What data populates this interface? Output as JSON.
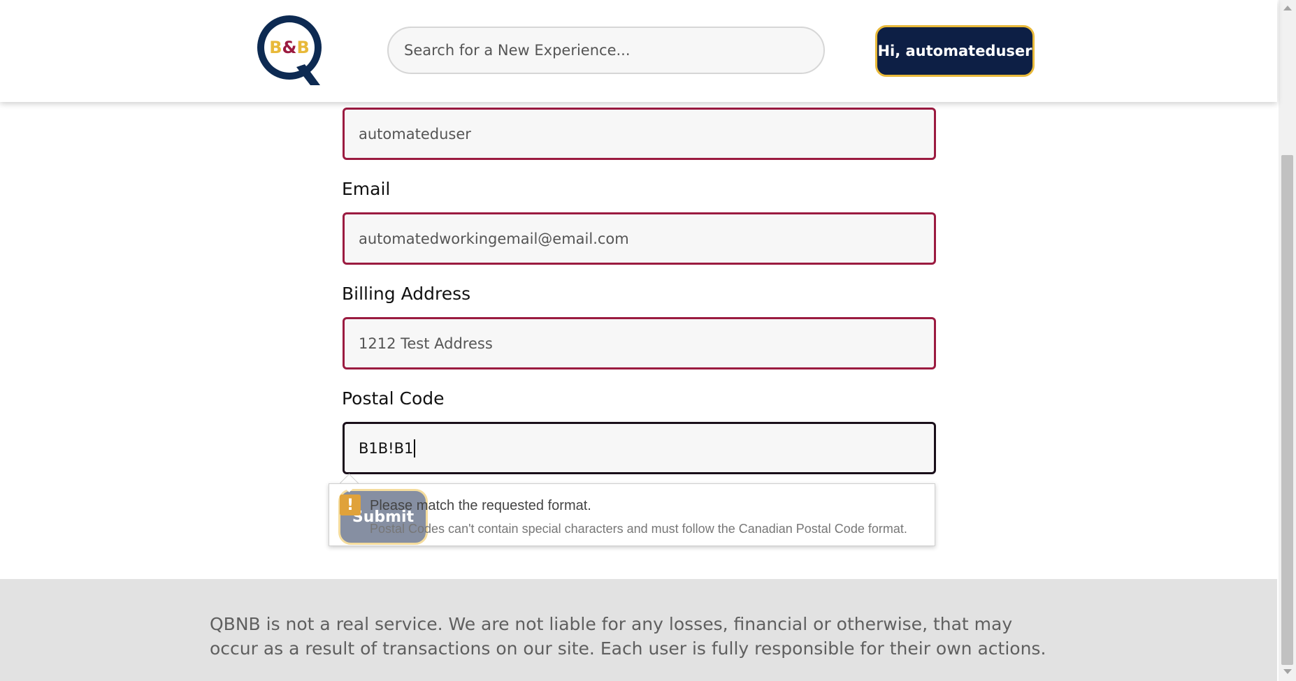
{
  "header": {
    "logo_text": "B&B",
    "search_placeholder": "Search for a New Experience...",
    "user_button_label": "Hi, automateduser"
  },
  "form": {
    "username_value": "automateduser",
    "email_label": "Email",
    "email_value": "automatedworkingemail@email.com",
    "billing_label": "Billing Address",
    "billing_value": "1212 Test Address",
    "postal_label": "Postal Code",
    "postal_value": "B1B!B1",
    "submit_label": "Submit"
  },
  "validation": {
    "title": "Please match the requested format.",
    "message": "Postal Codes can't contain special characters and must follow the Canadian Postal Code format.",
    "icon": "warning-icon"
  },
  "footer": {
    "disclaimer": "QBNB is not a real service. We are not liable for any losses, financial or otherwise, that may occur as a result of transactions on our site. Each user is fully responsible for their own actions."
  },
  "colors": {
    "brand_navy": "#0d1f45",
    "brand_gold": "#e8b93a",
    "field_border": "#9b1b40",
    "logo_text_red": "#9b1b40"
  }
}
